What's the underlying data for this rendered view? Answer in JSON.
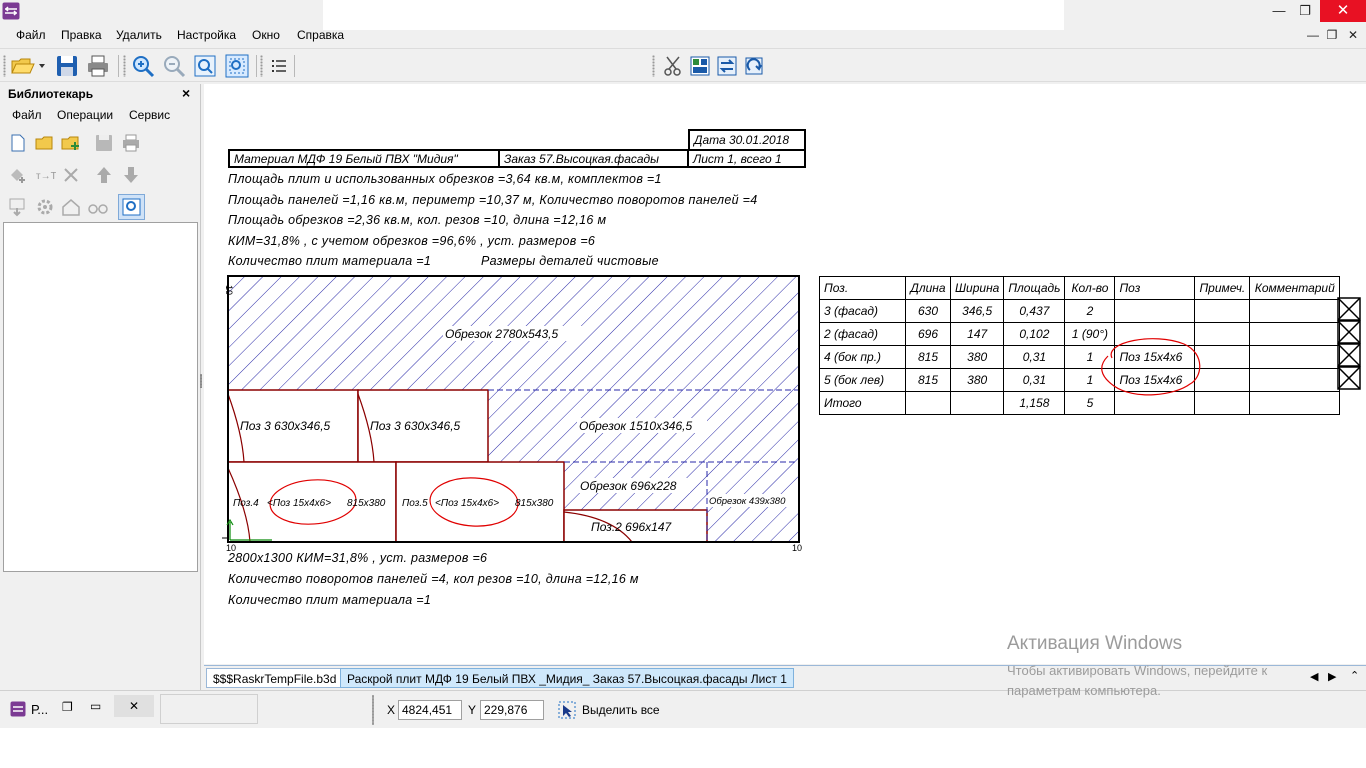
{
  "menu": {
    "items": [
      "Файл",
      "Правка",
      "Удалить",
      "Настройка",
      "Окно",
      "Справка"
    ]
  },
  "window_controls": {
    "minimize": "—",
    "restore": "❐",
    "close": "✕"
  },
  "librarian": {
    "title": "Библиотекарь",
    "close": "×",
    "menu": [
      "Файл",
      "Операции",
      "Сервис"
    ]
  },
  "drawing": {
    "date_cell": "Дата  30.01.2018",
    "material_cell": "Материал  МДФ 19 Белый ПВХ \"Мидия\"",
    "order_cell": "Заказ  57.Высоцкая.фасады",
    "sheet_cell": "Лист  1, всего  1",
    "info_lines": [
      "Площадь плит и использованных обрезков =3,64 кв.м, комплектов =1",
      "Площадь панелей =1,16 кв.м, периметр =10,37 м, Количество поворотов панелей =4",
      "Площадь обрезков =2,36 кв.м, кол. резов =10, длина =12,16 м",
      "КИМ=31,8% , с учетом обрезков =96,6% , уст. размеров =6",
      "Количество плит материала =1",
      "Размеры деталей чистовые"
    ],
    "sheet_labels": {
      "offcut_top": "Обрезок  2780x543,5",
      "pos3a": "Поз 3  630x346,5",
      "pos3b": "Поз 3  630x346,5",
      "offcut_mid": "Обрезок  1510x346,5",
      "pos4_prefix": "Поз.4",
      "pos4_note": "<Поз  15x4x6>",
      "pos4_size": "815x380",
      "pos5_prefix": "Поз.5",
      "pos5_note": "<Поз  15x4x6>",
      "pos5_size": "815x380",
      "offcut_small": "Обрезок  696x228",
      "offcut_right": "Обрезок  439x380",
      "pos2": "Поз.2  696x147",
      "axis_top": "10",
      "axis_bottom_left": "10",
      "axis_bottom_right": "10"
    },
    "footer_lines": [
      "2800x1300  КИМ=31,8% , уст. размеров =6",
      "Количество поворотов панелей =4, кол  резов =10, длина =12,16 м",
      "Количество плит материала =1"
    ],
    "parts_table": {
      "headers": [
        "Поз.",
        "Длина",
        "Ширина",
        "Площадь",
        "Кол-во",
        "Поз",
        "Примеч.",
        "Комментарий"
      ],
      "rows": [
        [
          "3  (фасад)",
          "630",
          "346,5",
          "0,437",
          "2",
          "",
          "",
          ""
        ],
        [
          "2  (фасад)",
          "696",
          "147",
          "0,102",
          "1  (90°)",
          "",
          "",
          ""
        ],
        [
          "4  (бок пр.)",
          "815",
          "380",
          "0,31",
          "1",
          "Поз  15x4x6",
          "",
          ""
        ],
        [
          "5  (бок лев)",
          "815",
          "380",
          "0,31",
          "1",
          "Поз  15x4x6",
          "",
          ""
        ]
      ],
      "total": [
        "Итого",
        "",
        "",
        "1,158",
        "5",
        "",
        "",
        ""
      ]
    }
  },
  "tabs": {
    "temp": "$$$RaskrTempFile.b3d",
    "active": "Раскрой плит МДФ 19 Белый ПВХ _Мидия_ Заказ 57.Высоцкая.фасады  Лист 1",
    "prev": "◀",
    "next": "▶",
    "collapse": "⌃"
  },
  "statusbar": {
    "mini_title": "Р...",
    "x_label": "X",
    "x_value": "4824,451",
    "y_label": "Y",
    "y_value": "229,876",
    "select_all": "Выделить все"
  },
  "watermark": {
    "title": "Активация Windows",
    "subtitle": "Чтобы активировать Windows, перейдите к параметрам компьютера."
  },
  "colors": {
    "hatch": "#2a2aa8",
    "panel_border": "#8b0000",
    "markup_red": "#e00000",
    "active_tab": "#cfe8fb"
  }
}
